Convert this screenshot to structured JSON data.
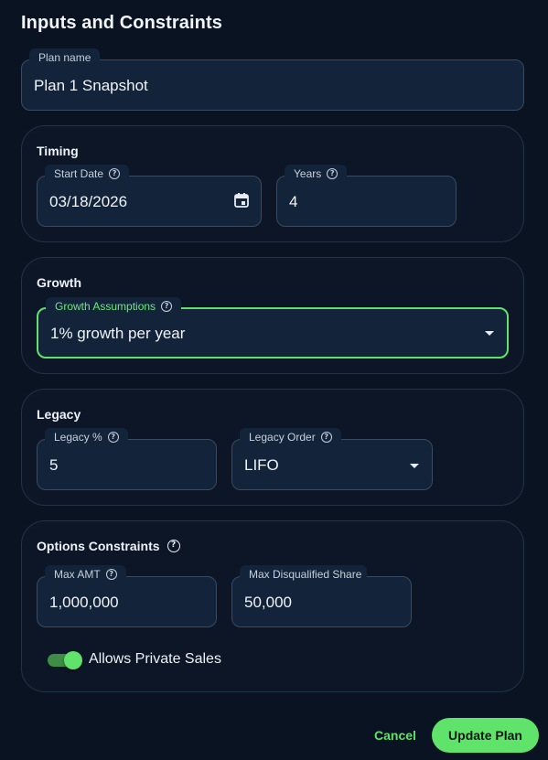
{
  "header": {
    "title": "Inputs and Constraints"
  },
  "plan": {
    "label": "Plan name",
    "value": "Plan 1 Snapshot"
  },
  "timing": {
    "title": "Timing",
    "start_date": {
      "label": "Start Date",
      "value": "03/18/2026"
    },
    "years": {
      "label": "Years",
      "value": "4"
    }
  },
  "growth": {
    "title": "Growth",
    "assumptions": {
      "label": "Growth Assumptions",
      "value": "1% growth per year"
    }
  },
  "legacy": {
    "title": "Legacy",
    "percent": {
      "label": "Legacy %",
      "value": "5"
    },
    "order": {
      "label": "Legacy Order",
      "value": "LIFO"
    }
  },
  "options": {
    "title": "Options Constraints",
    "max_amt": {
      "label": "Max AMT",
      "value": "1,000,000"
    },
    "max_disq": {
      "label": "Max Disqualified Share",
      "value": "50,000"
    },
    "private_sales": {
      "label": "Allows Private Sales",
      "enabled": true
    }
  },
  "actions": {
    "cancel": "Cancel",
    "update": "Update Plan"
  },
  "colors": {
    "accent": "#5fe36a",
    "background": "#0a1322",
    "field": "#13233a"
  },
  "icons": {
    "help": "help-circle-icon",
    "calendar": "calendar-icon",
    "dropdown": "chevron-down-icon"
  }
}
